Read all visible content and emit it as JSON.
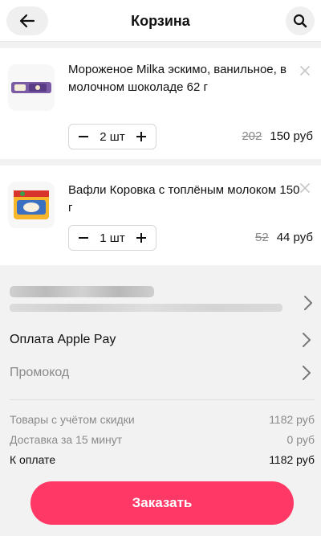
{
  "header": {
    "title": "Корзина",
    "back_icon": "arrow-left-icon",
    "search_icon": "search-icon"
  },
  "cart": {
    "items": [
      {
        "name": "Мороженое Milka эскимо, ванильное, в молочном шоколаде 62 г",
        "quantity": "2 шт",
        "old_price": "202",
        "price": "150 руб",
        "thumb_icon": "milka-ice-cream-image"
      },
      {
        "name": "Вафли Коровка с топлёным молоком 150 г",
        "quantity": "1 шт",
        "old_price": "52",
        "price": "44 руб",
        "thumb_icon": "korovka-wafers-image"
      }
    ]
  },
  "options": {
    "payment": "Оплата Apple Pay",
    "promo": "Промокод"
  },
  "summary": {
    "goods_label": "Товары с учётом скидки",
    "goods_value": "1182 руб",
    "delivery_label": "Доставка за 15 минут",
    "delivery_value": "0 руб",
    "total_label": "К оплате",
    "total_value": "1182 руб"
  },
  "actions": {
    "order": "Заказать"
  },
  "colors": {
    "accent": "#ff3865",
    "muted": "#8a8a8a",
    "background": "#f2f2f2"
  }
}
